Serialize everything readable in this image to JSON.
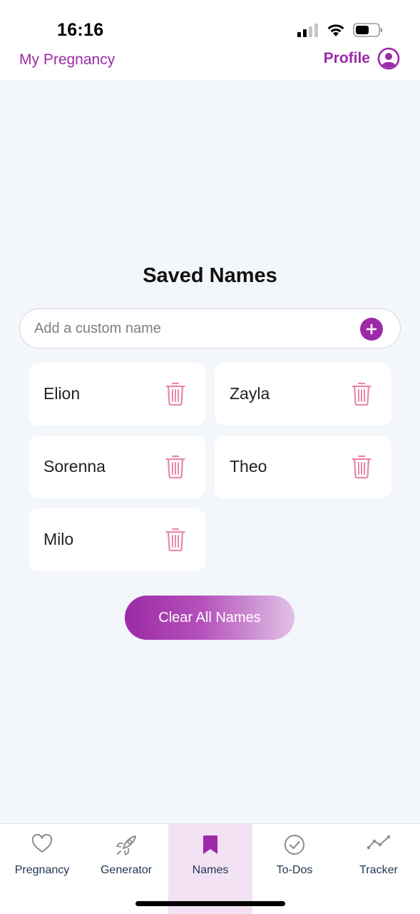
{
  "status_bar": {
    "time": "16:16"
  },
  "header": {
    "app_title": "My Pregnancy",
    "profile_label": "Profile"
  },
  "main": {
    "title": "Saved Names",
    "add_input": {
      "placeholder": "Add a custom name",
      "value": ""
    },
    "names": [
      "Elion",
      "Zayla",
      "Sorenna",
      "Theo",
      "Milo"
    ],
    "clear_button_label": "Clear All Names"
  },
  "tabs": [
    {
      "label": "Pregnancy",
      "icon": "heart-icon",
      "active": false
    },
    {
      "label": "Generator",
      "icon": "rocket-icon",
      "active": false
    },
    {
      "label": "Names",
      "icon": "bookmark-icon",
      "active": true
    },
    {
      "label": "To-Dos",
      "icon": "check-circle-icon",
      "active": false
    },
    {
      "label": "Tracker",
      "icon": "trend-line-icon",
      "active": false
    }
  ],
  "colors": {
    "accent": "#9c2aa6",
    "trash": "#e889a8",
    "background": "#f3f6fa",
    "active_tab": "#f2e2f4",
    "tab_label": "#1f3552"
  }
}
